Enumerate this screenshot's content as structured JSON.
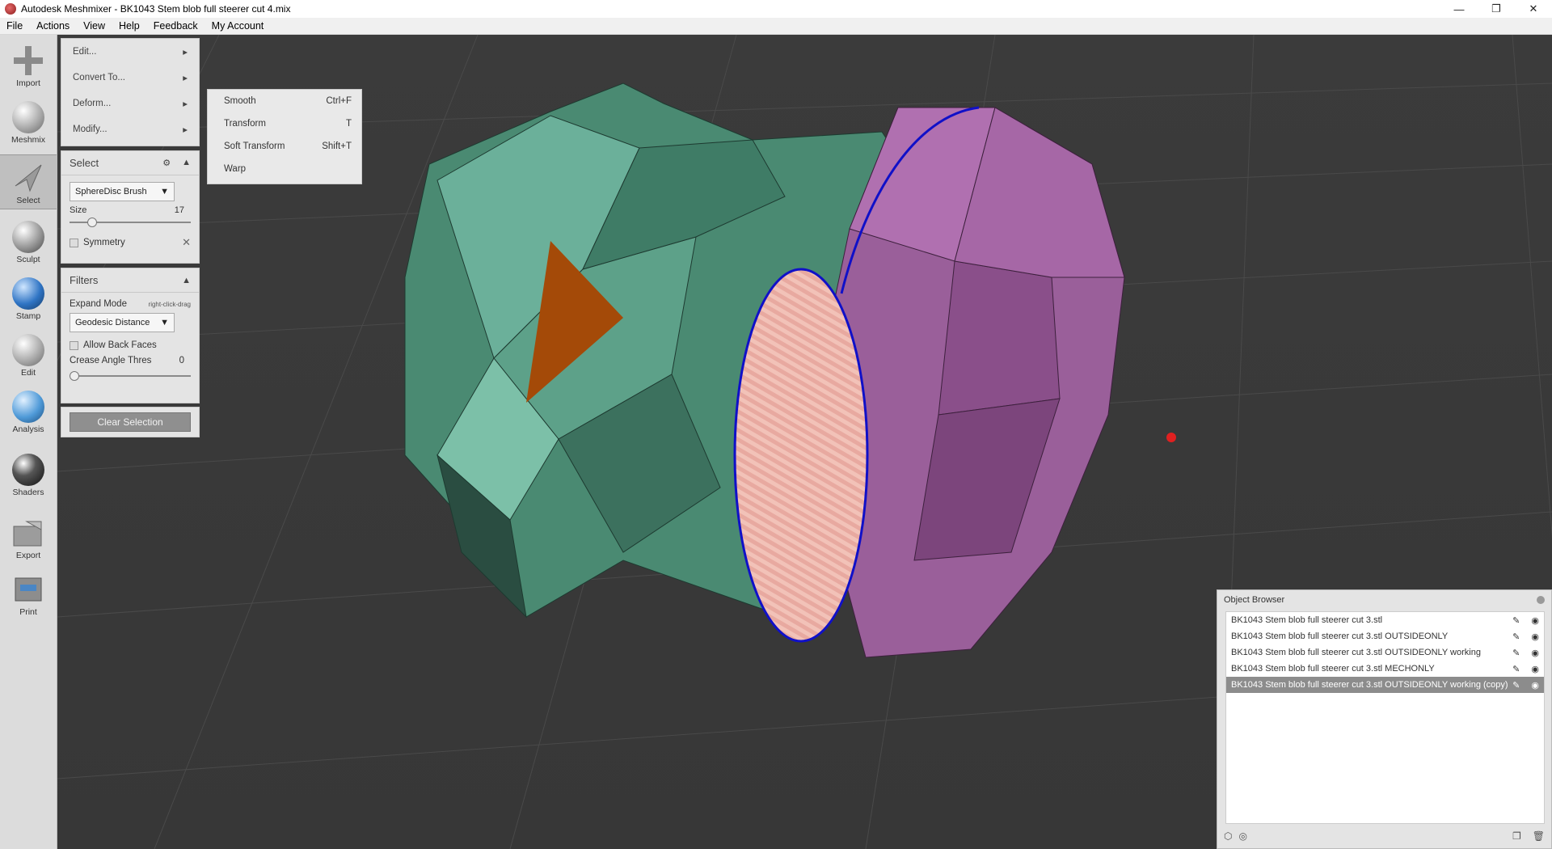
{
  "window": {
    "title": "Autodesk Meshmixer - BK1043 Stem blob full steerer cut 4.mix",
    "minimize": "—",
    "restore": "❐",
    "close": "✕"
  },
  "menubar": [
    "File",
    "Actions",
    "View",
    "Help",
    "Feedback",
    "My Account"
  ],
  "toolbar": [
    {
      "label": "Import",
      "icon": "plus-icon"
    },
    {
      "label": "Meshmix",
      "icon": "bunny-ball-icon"
    },
    {
      "label": "Select",
      "icon": "arrow-cursor-icon"
    },
    {
      "label": "Sculpt",
      "icon": "brush-icon"
    },
    {
      "label": "Stamp",
      "icon": "stamp-icon"
    },
    {
      "label": "Edit",
      "icon": "edit-ball-icon"
    },
    {
      "label": "Analysis",
      "icon": "mesh-ball-icon"
    },
    {
      "label": "Shaders",
      "icon": "shader-ball-icon"
    },
    {
      "label": "Export",
      "icon": "export-folder-icon"
    },
    {
      "label": "Print",
      "icon": "printer-icon"
    }
  ],
  "actions_menu": [
    "Edit...",
    "Convert To...",
    "Deform...",
    "Modify..."
  ],
  "deform_submenu": [
    {
      "label": "Smooth",
      "shortcut": "Ctrl+F"
    },
    {
      "label": "Transform",
      "shortcut": "T"
    },
    {
      "label": "Soft Transform",
      "shortcut": "Shift+T"
    },
    {
      "label": "Warp",
      "shortcut": ""
    }
  ],
  "select_panel": {
    "title": "Select",
    "brush": "SphereDisc Brush",
    "size_label": "Size",
    "size_value": "17",
    "size_fraction": 0.2,
    "symmetry_label": "Symmetry"
  },
  "filters_panel": {
    "title": "Filters",
    "expand_mode_label": "Expand Mode",
    "expand_mode_hint": "right-click-drag",
    "expand_mode_value": "Geodesic Distance",
    "allow_back_faces": "Allow Back Faces",
    "crease_label": "Crease Angle Thres",
    "crease_value": "0",
    "crease_fraction": 0.0
  },
  "clear_selection": "Clear Selection",
  "object_browser": {
    "title": "Object Browser",
    "items": [
      {
        "name": "BK1043 Stem blob full steerer cut 3.stl",
        "selected": false
      },
      {
        "name": "BK1043 Stem blob full steerer cut 3.stl OUTSIDEONLY",
        "selected": false
      },
      {
        "name": "BK1043 Stem blob full steerer cut 3.stl OUTSIDEONLY working",
        "selected": false
      },
      {
        "name": "BK1043 Stem blob full steerer cut 3.stl MECHONLY",
        "selected": false
      },
      {
        "name": "BK1043 Stem blob full steerer cut 3.stl OUTSIDEONLY working (copy)",
        "selected": true
      }
    ]
  },
  "colors": {
    "mesh_green": "#4e8f76",
    "mesh_purple": "#9a5f9a",
    "selection_orange": "#a44a08",
    "highlight_blue": "#1010c8",
    "pivot_red": "#e02020"
  }
}
